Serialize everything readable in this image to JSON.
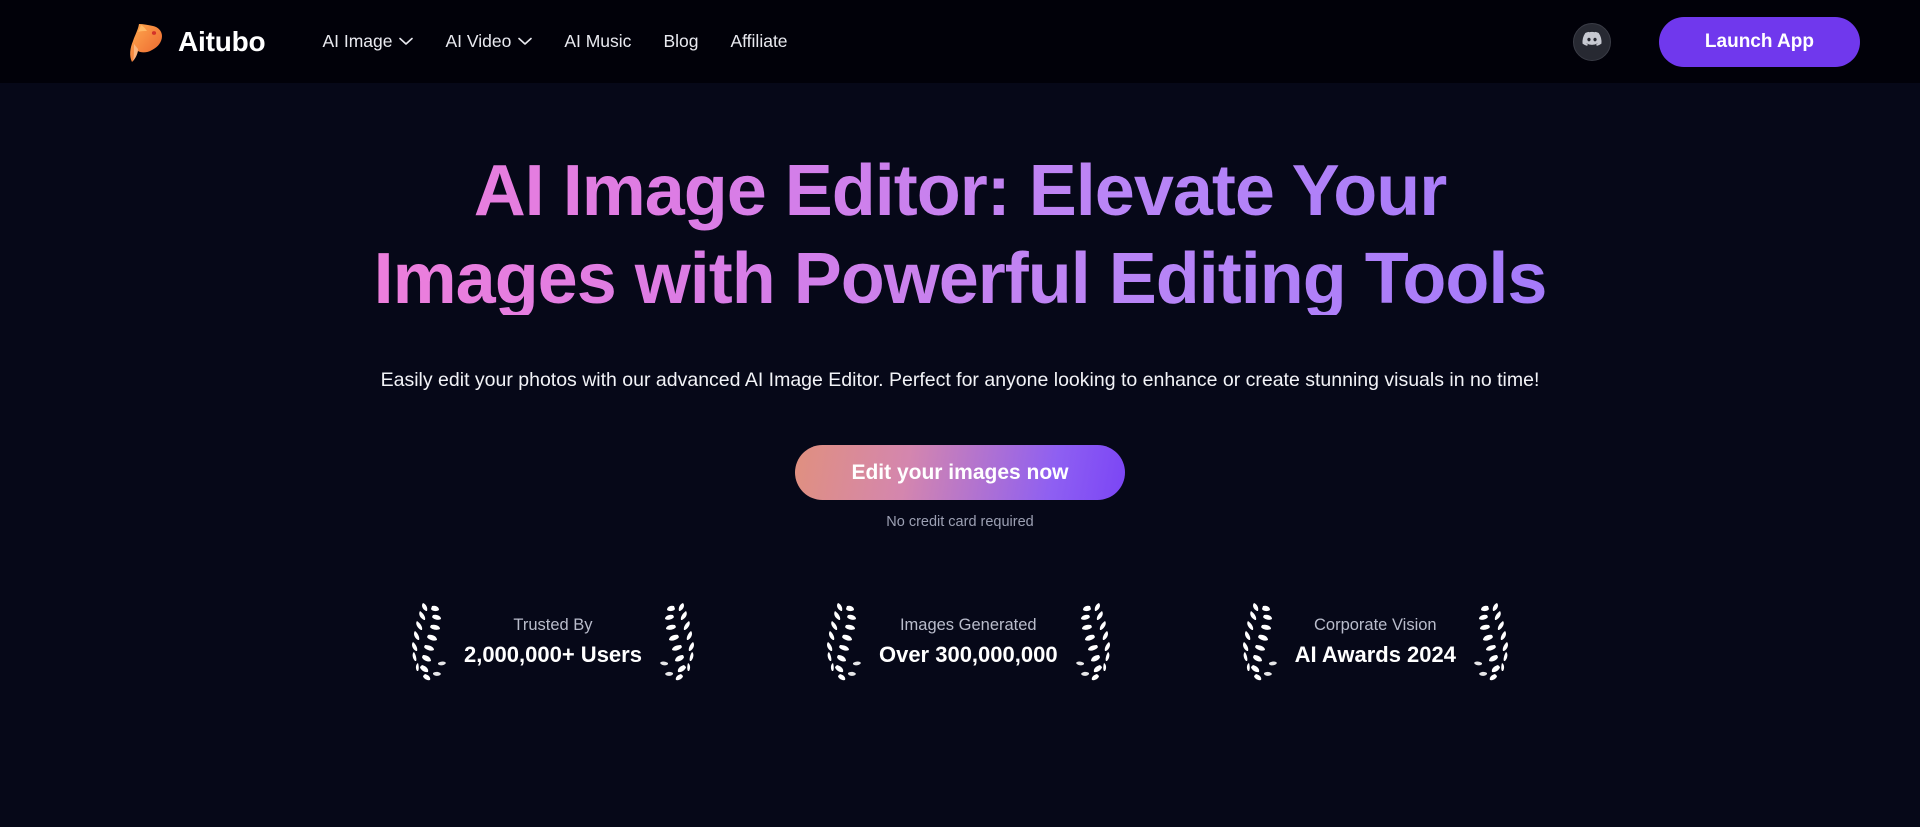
{
  "header": {
    "brand": {
      "name": "Aitubo",
      "logo_icon": "capybara-logo-icon",
      "logo_color": "#f2803a"
    },
    "nav": [
      {
        "label": "AI Image",
        "has_dropdown": true,
        "icon": "chevron-down-icon"
      },
      {
        "label": "AI Video",
        "has_dropdown": true,
        "icon": "chevron-down-icon"
      },
      {
        "label": "AI Music",
        "has_dropdown": false
      },
      {
        "label": "Blog",
        "has_dropdown": false
      },
      {
        "label": "Affiliate",
        "has_dropdown": false
      }
    ],
    "discord_icon": "discord-icon",
    "launch_label": "Launch App",
    "launch_color": "#7038ed",
    "background": "#010109"
  },
  "hero": {
    "headline_line1": "AI Image Editor: Elevate Your",
    "headline_line2": "Images with Powerful Editing Tools",
    "headline_gradient_start": "#f07fda",
    "headline_gradient_end": "#a279fb",
    "subtitle": "Easily edit your photos with our advanced AI Image Editor. Perfect for anyone looking to enhance or create stunning visuals in no time!",
    "cta_label": "Edit your images now",
    "cta_gradient_start": "#e0907f",
    "cta_gradient_end": "#7b45f5",
    "cta_note": "No credit card required",
    "background": "#060818"
  },
  "stats": [
    {
      "label": "Trusted By",
      "value": "2,000,000+ Users",
      "icon": "laurel-wreath-icon"
    },
    {
      "label": "Images Generated",
      "value": "Over 300,000,000",
      "icon": "laurel-wreath-icon"
    },
    {
      "label": "Corporate Vision",
      "value": "AI Awards 2024",
      "icon": "laurel-wreath-icon"
    }
  ]
}
